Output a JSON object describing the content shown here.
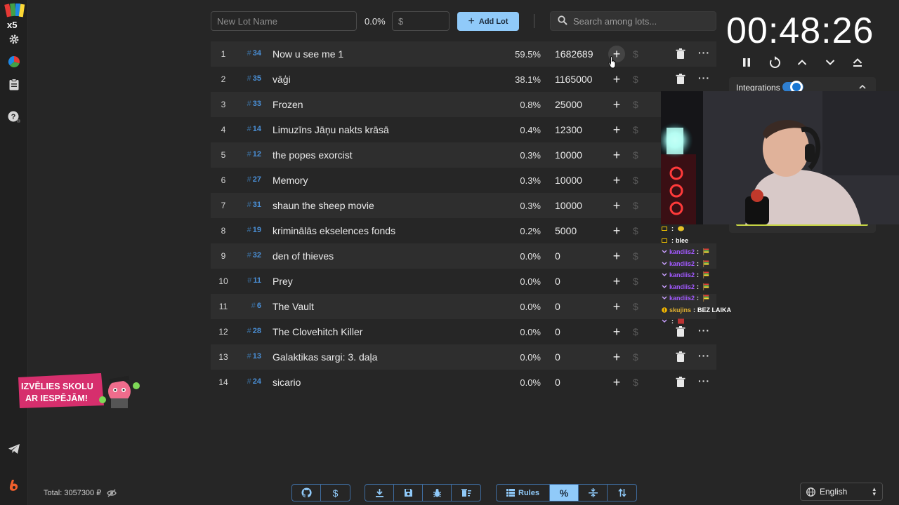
{
  "toolbar": {
    "lot_name_placeholder": "New Lot Name",
    "percent_readout": "0.0%",
    "amount_placeholder": "$",
    "add_lot_label": "Add Lot",
    "search_placeholder": "Search among lots..."
  },
  "timer": {
    "display": "00:48:26"
  },
  "integrations": {
    "label": "Integrations",
    "enabled": true
  },
  "lots": [
    {
      "index": "1",
      "id": "34",
      "name": "Now u see me 1",
      "percent": "59.5%",
      "amount": "1682689"
    },
    {
      "index": "2",
      "id": "35",
      "name": "vāģi",
      "percent": "38.1%",
      "amount": "1165000"
    },
    {
      "index": "3",
      "id": "33",
      "name": "Frozen",
      "percent": "0.8%",
      "amount": "25000"
    },
    {
      "index": "4",
      "id": "14",
      "name": "Limuzīns Jāņu nakts krāsā",
      "percent": "0.4%",
      "amount": "12300"
    },
    {
      "index": "5",
      "id": "12",
      "name": "the popes exorcist",
      "percent": "0.3%",
      "amount": "10000"
    },
    {
      "index": "6",
      "id": "27",
      "name": "Memory",
      "percent": "0.3%",
      "amount": "10000"
    },
    {
      "index": "7",
      "id": "31",
      "name": "shaun the sheep movie",
      "percent": "0.3%",
      "amount": "10000"
    },
    {
      "index": "8",
      "id": "19",
      "name": "kriminālās ekselences fonds",
      "percent": "0.2%",
      "amount": "5000"
    },
    {
      "index": "9",
      "id": "32",
      "name": "den of thieves",
      "percent": "0.0%",
      "amount": "0"
    },
    {
      "index": "10",
      "id": "11",
      "name": "Prey",
      "percent": "0.0%",
      "amount": "0"
    },
    {
      "index": "11",
      "id": "6",
      "name": "The Vault",
      "percent": "0.0%",
      "amount": "0"
    },
    {
      "index": "12",
      "id": "28",
      "name": "The Clovehitch Killer",
      "percent": "0.0%",
      "amount": "0"
    },
    {
      "index": "13",
      "id": "13",
      "name": "Galaktikas sargi: 3. daļa",
      "percent": "0.0%",
      "amount": "0"
    },
    {
      "index": "14",
      "id": "24",
      "name": "sicario",
      "percent": "0.0%",
      "amount": "0"
    }
  ],
  "id_prefix": "#",
  "dollar_symbol": "$",
  "chat": [
    {
      "nick": "",
      "text": ""
    },
    {
      "nick": "",
      "text": "blee"
    },
    {
      "nick": "kandiis2",
      "text": ""
    },
    {
      "nick": "kandiis2",
      "text": ""
    },
    {
      "nick": "kandiis2",
      "text": ""
    },
    {
      "nick": "kandiis2",
      "text": ""
    },
    {
      "nick": "kandiis2",
      "text": ""
    },
    {
      "nick": "skujins",
      "text": "BEZ LAIKA"
    },
    {
      "nick": "",
      "text": ""
    }
  ],
  "promo": {
    "line1": "IZVĒLIES SKOLU",
    "line2": "AR IESPĒJĀM!"
  },
  "footer": {
    "total": "Total: 3057300 ₽",
    "rules_label": "Rules",
    "language": "English"
  },
  "colors": {
    "accent": "#90caf9",
    "lot_id": "#4a8fd6",
    "background": "#262626"
  }
}
